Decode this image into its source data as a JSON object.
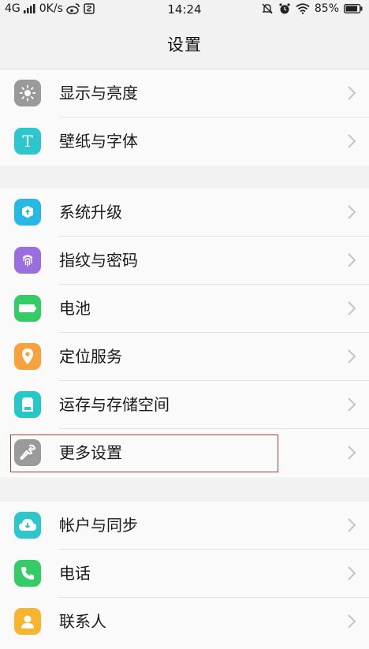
{
  "status_bar": {
    "network": "4G",
    "speed": "0K/s",
    "time": "14:24",
    "battery": "85%"
  },
  "header": {
    "title": "设置"
  },
  "groups": [
    {
      "items": [
        {
          "label": "显示与亮度",
          "icon": "brightness-icon",
          "color": "#9a9a9a"
        },
        {
          "label": "壁纸与字体",
          "icon": "font-icon",
          "color": "#2cc6cc"
        }
      ]
    },
    {
      "items": [
        {
          "label": "系统升级",
          "icon": "system-update-icon",
          "color": "#27b9e6"
        },
        {
          "label": "指纹与密码",
          "icon": "fingerprint-icon",
          "color": "#9b6ee0"
        },
        {
          "label": "电池",
          "icon": "battery-icon",
          "color": "#33cc66"
        },
        {
          "label": "定位服务",
          "icon": "location-icon",
          "color": "#f7a23a"
        },
        {
          "label": "运存与存储空间",
          "icon": "storage-icon",
          "color": "#25c7c7"
        },
        {
          "label": "更多设置",
          "icon": "wrench-icon",
          "color": "#9a9a9a"
        }
      ]
    },
    {
      "items": [
        {
          "label": "帐户与同步",
          "icon": "cloud-sync-icon",
          "color": "#2cc6cc"
        },
        {
          "label": "电话",
          "icon": "phone-icon",
          "color": "#33cc66"
        },
        {
          "label": "联系人",
          "icon": "contacts-icon",
          "color": "#f7b52e"
        }
      ]
    }
  ]
}
